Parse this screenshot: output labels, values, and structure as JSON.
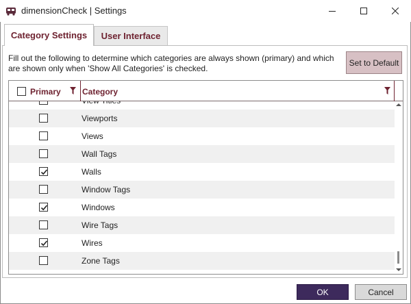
{
  "window": {
    "title": "dimensionCheck | Settings",
    "icon": "app-icon",
    "controls": {
      "minimize": "minimize-icon",
      "maximize": "maximize-icon",
      "close": "close-icon"
    }
  },
  "tabs": [
    {
      "label": "Category Settings",
      "active": true
    },
    {
      "label": "User Interface",
      "active": false
    }
  ],
  "instructions": "Fill out the following to determine which categories are always shown (primary) and which are shown only when 'Show All Categories' is checked.",
  "buttons": {
    "set_default": "Set to Default",
    "ok": "OK",
    "cancel": "Cancel"
  },
  "grid": {
    "columns": {
      "primary": "Primary",
      "category": "Category"
    },
    "rows": [
      {
        "category": "View Titles",
        "primary": false
      },
      {
        "category": "Viewports",
        "primary": false
      },
      {
        "category": "Views",
        "primary": false
      },
      {
        "category": "Wall Tags",
        "primary": false
      },
      {
        "category": "Walls",
        "primary": true
      },
      {
        "category": "Window Tags",
        "primary": false
      },
      {
        "category": "Windows",
        "primary": true
      },
      {
        "category": "Wire Tags",
        "primary": false
      },
      {
        "category": "Wires",
        "primary": true
      },
      {
        "category": "Zone Tags",
        "primary": false
      }
    ]
  },
  "colors": {
    "accent": "#6e2230",
    "ok_button": "#3d2a5c",
    "default_button": "#d7c0c4",
    "alt_row": "#f0f0f0"
  }
}
